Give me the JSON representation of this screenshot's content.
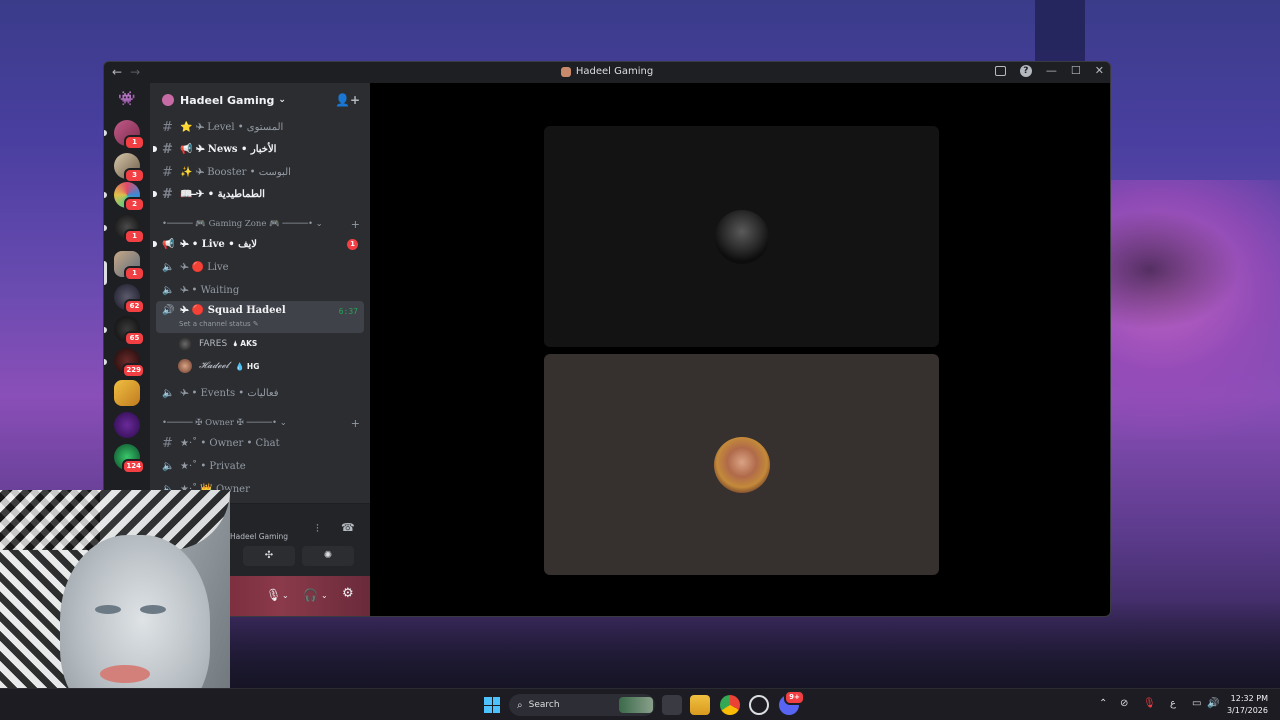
{
  "window": {
    "title": "Hadeel Gaming"
  },
  "server": {
    "name": "Hadeel Gaming",
    "dropdown_glyph": "⌄"
  },
  "rail": {
    "badges": [
      "1",
      "3",
      "2",
      "1",
      "1",
      "62",
      "65",
      "229",
      "124"
    ]
  },
  "channels": {
    "level": "⭐ ✈̶ Level • المستوى",
    "news": "📢 ✈̶ News • الأخبار",
    "booster": "✨ ✈̶ Booster • البوست",
    "maadiya": "📖 ✈̶ • الطماطيدية",
    "live_text": "✈̶ • Live • لايف",
    "live_badge": "1",
    "live_voice": "✈̶ 🔴 Live",
    "waiting": "✈̶ • Waiting",
    "squad": "✈̶ 🔴 Squad Hadeel",
    "squad_time": "6:37",
    "squad_status": "Set a channel status ✎",
    "events": "✈̶ • Events • فعاليات",
    "owner_chat": "★·˚ • Owner • Chat",
    "private": "★·˚ • Private",
    "owner": "★·˚ 👑 Owner"
  },
  "categories": {
    "gaming_zone": "•───── 🎮 Gaming Zone 🎮 ─────• ⌄",
    "owner": "•───── ✠ Owner ✠ ─────• ⌄"
  },
  "members": [
    {
      "name": "FARES",
      "tag": "🌢 AKS"
    },
    {
      "name": "𝓗𝓪𝓭𝓮𝓮𝓵",
      "tag": "💧 HG"
    }
  ],
  "voice": {
    "server_name": "Hadeel Gaming"
  },
  "taskbar": {
    "search_placeholder": "Search",
    "time": "12:32 PM",
    "date": "3/17/2026",
    "lang": "ع",
    "discord_badge": "9+"
  },
  "colors": {
    "accent_green": "#23a559",
    "badge_red": "#f23f43",
    "sidebar_bg": "#2b2d31",
    "stage_bg": "#000000"
  }
}
